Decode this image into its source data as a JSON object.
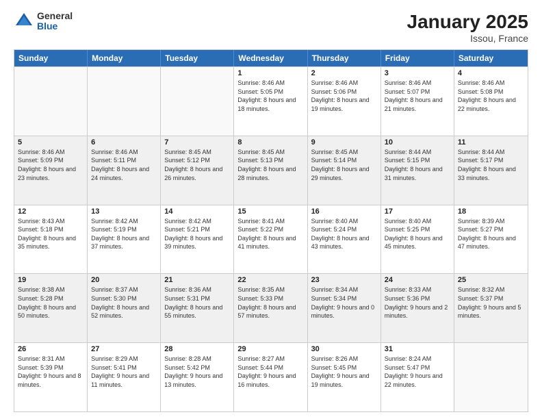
{
  "header": {
    "logo": {
      "general": "General",
      "blue": "Blue"
    },
    "title": "January 2025",
    "location": "Issou, France"
  },
  "days_of_week": [
    "Sunday",
    "Monday",
    "Tuesday",
    "Wednesday",
    "Thursday",
    "Friday",
    "Saturday"
  ],
  "weeks": [
    [
      {
        "day": "",
        "info": ""
      },
      {
        "day": "",
        "info": ""
      },
      {
        "day": "",
        "info": ""
      },
      {
        "day": "1",
        "info": "Sunrise: 8:46 AM\nSunset: 5:05 PM\nDaylight: 8 hours\nand 18 minutes."
      },
      {
        "day": "2",
        "info": "Sunrise: 8:46 AM\nSunset: 5:06 PM\nDaylight: 8 hours\nand 19 minutes."
      },
      {
        "day": "3",
        "info": "Sunrise: 8:46 AM\nSunset: 5:07 PM\nDaylight: 8 hours\nand 21 minutes."
      },
      {
        "day": "4",
        "info": "Sunrise: 8:46 AM\nSunset: 5:08 PM\nDaylight: 8 hours\nand 22 minutes."
      }
    ],
    [
      {
        "day": "5",
        "info": "Sunrise: 8:46 AM\nSunset: 5:09 PM\nDaylight: 8 hours\nand 23 minutes."
      },
      {
        "day": "6",
        "info": "Sunrise: 8:46 AM\nSunset: 5:11 PM\nDaylight: 8 hours\nand 24 minutes."
      },
      {
        "day": "7",
        "info": "Sunrise: 8:45 AM\nSunset: 5:12 PM\nDaylight: 8 hours\nand 26 minutes."
      },
      {
        "day": "8",
        "info": "Sunrise: 8:45 AM\nSunset: 5:13 PM\nDaylight: 8 hours\nand 28 minutes."
      },
      {
        "day": "9",
        "info": "Sunrise: 8:45 AM\nSunset: 5:14 PM\nDaylight: 8 hours\nand 29 minutes."
      },
      {
        "day": "10",
        "info": "Sunrise: 8:44 AM\nSunset: 5:15 PM\nDaylight: 8 hours\nand 31 minutes."
      },
      {
        "day": "11",
        "info": "Sunrise: 8:44 AM\nSunset: 5:17 PM\nDaylight: 8 hours\nand 33 minutes."
      }
    ],
    [
      {
        "day": "12",
        "info": "Sunrise: 8:43 AM\nSunset: 5:18 PM\nDaylight: 8 hours\nand 35 minutes."
      },
      {
        "day": "13",
        "info": "Sunrise: 8:42 AM\nSunset: 5:19 PM\nDaylight: 8 hours\nand 37 minutes."
      },
      {
        "day": "14",
        "info": "Sunrise: 8:42 AM\nSunset: 5:21 PM\nDaylight: 8 hours\nand 39 minutes."
      },
      {
        "day": "15",
        "info": "Sunrise: 8:41 AM\nSunset: 5:22 PM\nDaylight: 8 hours\nand 41 minutes."
      },
      {
        "day": "16",
        "info": "Sunrise: 8:40 AM\nSunset: 5:24 PM\nDaylight: 8 hours\nand 43 minutes."
      },
      {
        "day": "17",
        "info": "Sunrise: 8:40 AM\nSunset: 5:25 PM\nDaylight: 8 hours\nand 45 minutes."
      },
      {
        "day": "18",
        "info": "Sunrise: 8:39 AM\nSunset: 5:27 PM\nDaylight: 8 hours\nand 47 minutes."
      }
    ],
    [
      {
        "day": "19",
        "info": "Sunrise: 8:38 AM\nSunset: 5:28 PM\nDaylight: 8 hours\nand 50 minutes."
      },
      {
        "day": "20",
        "info": "Sunrise: 8:37 AM\nSunset: 5:30 PM\nDaylight: 8 hours\nand 52 minutes."
      },
      {
        "day": "21",
        "info": "Sunrise: 8:36 AM\nSunset: 5:31 PM\nDaylight: 8 hours\nand 55 minutes."
      },
      {
        "day": "22",
        "info": "Sunrise: 8:35 AM\nSunset: 5:33 PM\nDaylight: 8 hours\nand 57 minutes."
      },
      {
        "day": "23",
        "info": "Sunrise: 8:34 AM\nSunset: 5:34 PM\nDaylight: 9 hours\nand 0 minutes."
      },
      {
        "day": "24",
        "info": "Sunrise: 8:33 AM\nSunset: 5:36 PM\nDaylight: 9 hours\nand 2 minutes."
      },
      {
        "day": "25",
        "info": "Sunrise: 8:32 AM\nSunset: 5:37 PM\nDaylight: 9 hours\nand 5 minutes."
      }
    ],
    [
      {
        "day": "26",
        "info": "Sunrise: 8:31 AM\nSunset: 5:39 PM\nDaylight: 9 hours\nand 8 minutes."
      },
      {
        "day": "27",
        "info": "Sunrise: 8:29 AM\nSunset: 5:41 PM\nDaylight: 9 hours\nand 11 minutes."
      },
      {
        "day": "28",
        "info": "Sunrise: 8:28 AM\nSunset: 5:42 PM\nDaylight: 9 hours\nand 13 minutes."
      },
      {
        "day": "29",
        "info": "Sunrise: 8:27 AM\nSunset: 5:44 PM\nDaylight: 9 hours\nand 16 minutes."
      },
      {
        "day": "30",
        "info": "Sunrise: 8:26 AM\nSunset: 5:45 PM\nDaylight: 9 hours\nand 19 minutes."
      },
      {
        "day": "31",
        "info": "Sunrise: 8:24 AM\nSunset: 5:47 PM\nDaylight: 9 hours\nand 22 minutes."
      },
      {
        "day": "",
        "info": ""
      }
    ]
  ]
}
